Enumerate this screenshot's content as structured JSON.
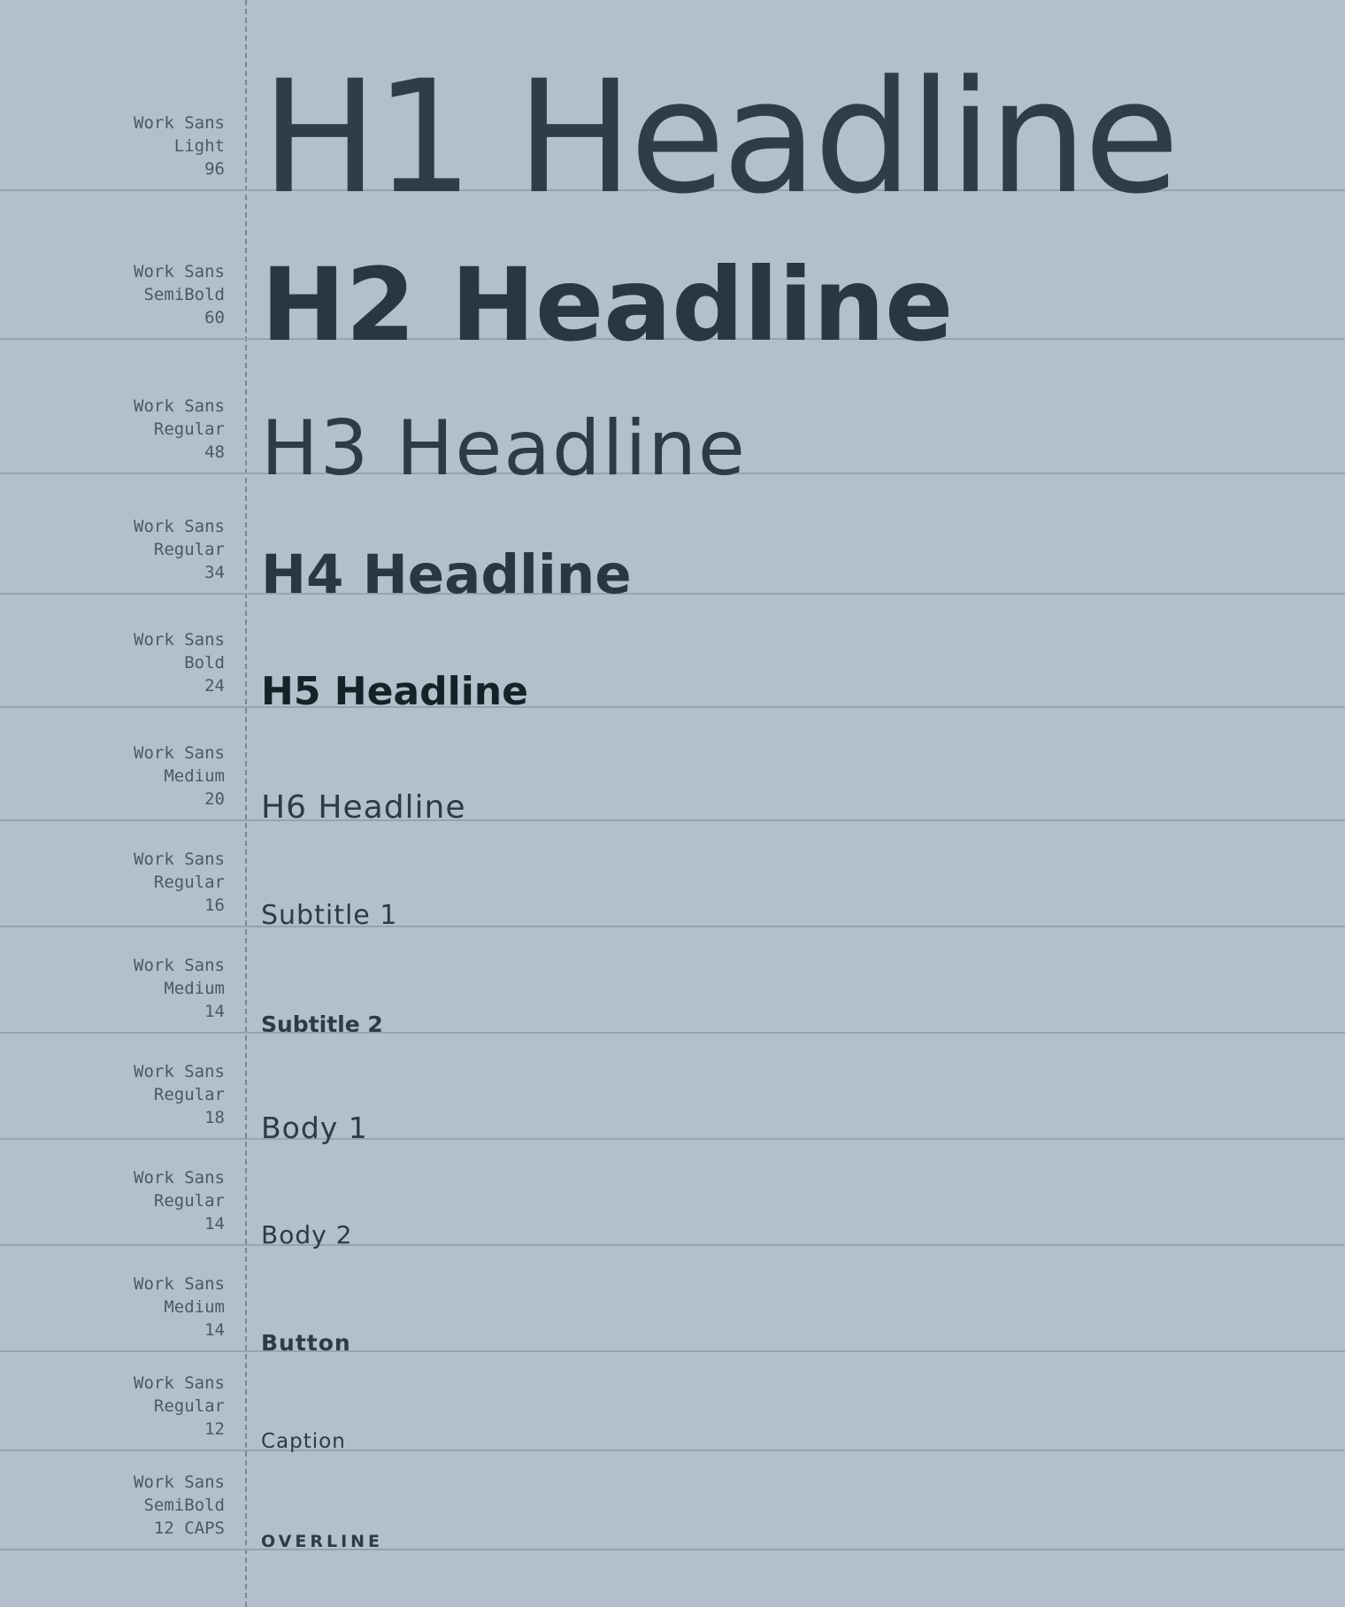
{
  "styles": [
    {
      "key": "h1",
      "font": "Work Sans",
      "weight": "Light",
      "size": "96",
      "sample": "H1 Headline"
    },
    {
      "key": "h2",
      "font": "Work Sans",
      "weight": "SemiBold",
      "size": "60",
      "sample": "H2 Headline"
    },
    {
      "key": "h3",
      "font": "Work Sans",
      "weight": "Regular",
      "size": "48",
      "sample": "H3 Headline"
    },
    {
      "key": "h4",
      "font": "Work Sans",
      "weight": "Regular",
      "size": "34",
      "sample": "H4 Headline"
    },
    {
      "key": "h5",
      "font": "Work Sans",
      "weight": "Bold",
      "size": "24",
      "sample": "H5 Headline"
    },
    {
      "key": "h6",
      "font": "Work Sans",
      "weight": "Medium",
      "size": "20",
      "sample": "H6 Headline"
    },
    {
      "key": "sub1",
      "font": "Work Sans",
      "weight": "Regular",
      "size": "16",
      "sample": "Subtitle 1"
    },
    {
      "key": "sub2",
      "font": "Work Sans",
      "weight": "Medium",
      "size": "14",
      "sample": "Subtitle 2"
    },
    {
      "key": "body1",
      "font": "Work Sans",
      "weight": "Regular",
      "size": "18",
      "sample": "Body 1"
    },
    {
      "key": "body2",
      "font": "Work Sans",
      "weight": "Regular",
      "size": "14",
      "sample": "Body 2"
    },
    {
      "key": "button",
      "font": "Work Sans",
      "weight": "Medium",
      "size": "14",
      "sample": "Button"
    },
    {
      "key": "caption",
      "font": "Work Sans",
      "weight": "Regular",
      "size": "12",
      "sample": "Caption"
    },
    {
      "key": "overline",
      "font": "Work Sans",
      "weight": "SemiBold",
      "size": "12 CAPS",
      "sample": "OVERLINE"
    }
  ]
}
